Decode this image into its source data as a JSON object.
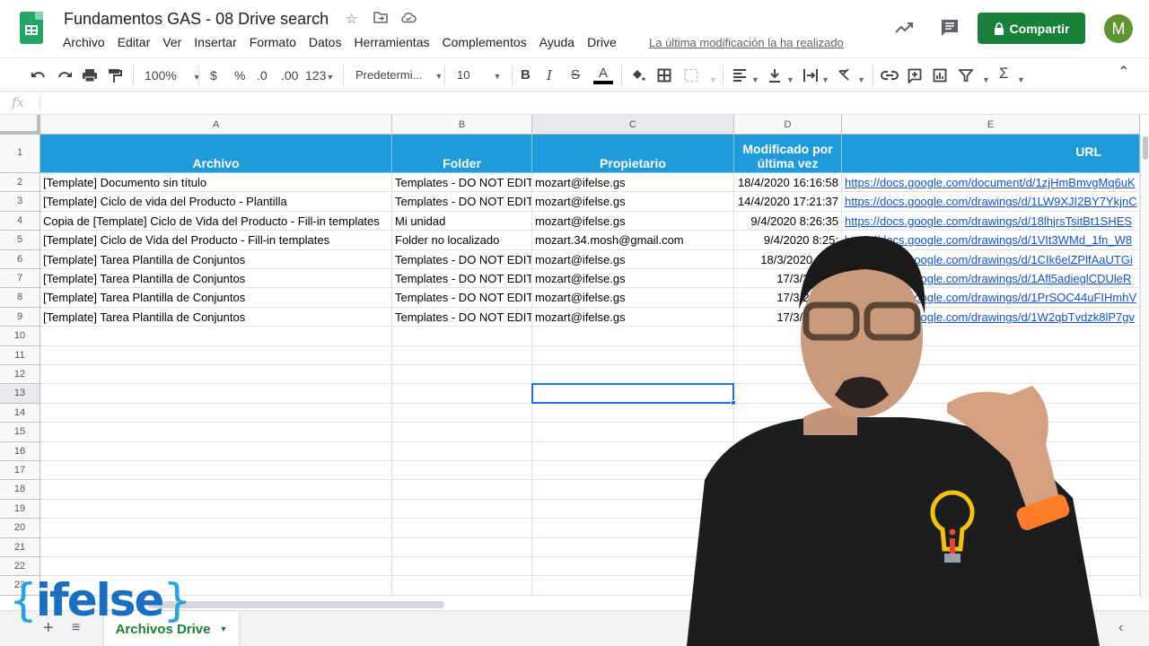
{
  "app": {
    "doc_title": "Fundamentos GAS - 08 Drive search",
    "menu": [
      "Archivo",
      "Editar",
      "Ver",
      "Insertar",
      "Formato",
      "Datos",
      "Herramientas",
      "Complementos",
      "Ayuda",
      "Drive"
    ],
    "last_edit": "La última modificación la ha realizado",
    "share_label": "Compartir",
    "avatar_initial": "M",
    "colors": {
      "share": "#188038",
      "header_fill": "#1f9bdb",
      "link": "#1155cc",
      "avatar": "#5f9433",
      "selection": "#1a73e8"
    }
  },
  "toolbar": {
    "zoom": "100%",
    "currency": "$",
    "percent": "%",
    "dec_less": ".0",
    "dec_more": ".00",
    "more_formats": "123",
    "font": "Predetermi...",
    "font_size": "10",
    "bold": "B",
    "italic": "I",
    "strike": "S",
    "text_color": "A",
    "sum": "Σ"
  },
  "formula_bar": {
    "fx": "fx",
    "value": ""
  },
  "grid": {
    "columns": [
      "A",
      "B",
      "C",
      "D",
      "E"
    ],
    "row_numbers": [
      "1",
      "2",
      "3",
      "4",
      "5",
      "6",
      "7",
      "8",
      "9",
      "10",
      "11",
      "12",
      "13",
      "14",
      "15",
      "16",
      "17",
      "18",
      "19",
      "20",
      "21",
      "22",
      "23"
    ],
    "selected_cell": "C13",
    "headers": [
      "Archivo",
      "Folder",
      "Propietario",
      "Modificado por última vez",
      "URL"
    ],
    "rows": [
      [
        "[Template] Documento sin título",
        "Templates - DO NOT EDIT",
        "mozart@ifelse.gs",
        "18/4/2020 16:16:58",
        "https://docs.google.com/document/d/1zjHmBmvgMq6uK"
      ],
      [
        "[Template] Ciclo de vida del Producto - Plantilla",
        "Templates - DO NOT EDIT",
        "mozart@ifelse.gs",
        "14/4/2020 17:21:37",
        "https://docs.google.com/drawings/d/1LW9XJI2BY7YkjnC"
      ],
      [
        "Copia de [Template] Ciclo de Vida del Producto - Fill-in templates",
        "Mi unidad",
        "mozart@ifelse.gs",
        "9/4/2020 8:26:35",
        "https://docs.google.com/drawings/d/18lhjrsTsitBt1SHES"
      ],
      [
        "[Template] Ciclo de Vida del Producto - Fill-in templates",
        "Folder no localizado",
        "mozart.34.mosh@gmail.com",
        "9/4/2020 8:25:",
        "https://docs.google.com/drawings/d/1VIt3WMd_1fn_W8"
      ],
      [
        "[Template] Tarea Plantilla de Conjuntos",
        "Templates - DO NOT EDIT",
        "mozart@ifelse.gs",
        "18/3/2020 17:0",
        "https://docs.google.com/drawings/d/1CIk6elZPlfAaUTGi"
      ],
      [
        "[Template] Tarea Plantilla de Conjuntos",
        "Templates - DO NOT EDIT",
        "mozart@ifelse.gs",
        "17/3/2020 2",
        "https://docs.google.com/drawings/d/1Afl5adieglCDUleR"
      ],
      [
        "[Template] Tarea Plantilla de Conjuntos",
        "Templates - DO NOT EDIT",
        "mozart@ifelse.gs",
        "17/3/2020 2",
        "https://docs.google.com/drawings/d/1PrSOC44uFIHmhV"
      ],
      [
        "[Template] Tarea Plantilla de Conjuntos",
        "Templates - DO NOT EDIT",
        "mozart@ifelse.gs",
        "17/3/2020 2",
        "https://docs.google.com/drawings/d/1W2qbTvdzk8lP7gv"
      ]
    ]
  },
  "sheets": {
    "active_tab": "Archivos Drive"
  },
  "overlay": {
    "brand_open": "{",
    "brand_word": "ifelse",
    "brand_close": "}"
  }
}
